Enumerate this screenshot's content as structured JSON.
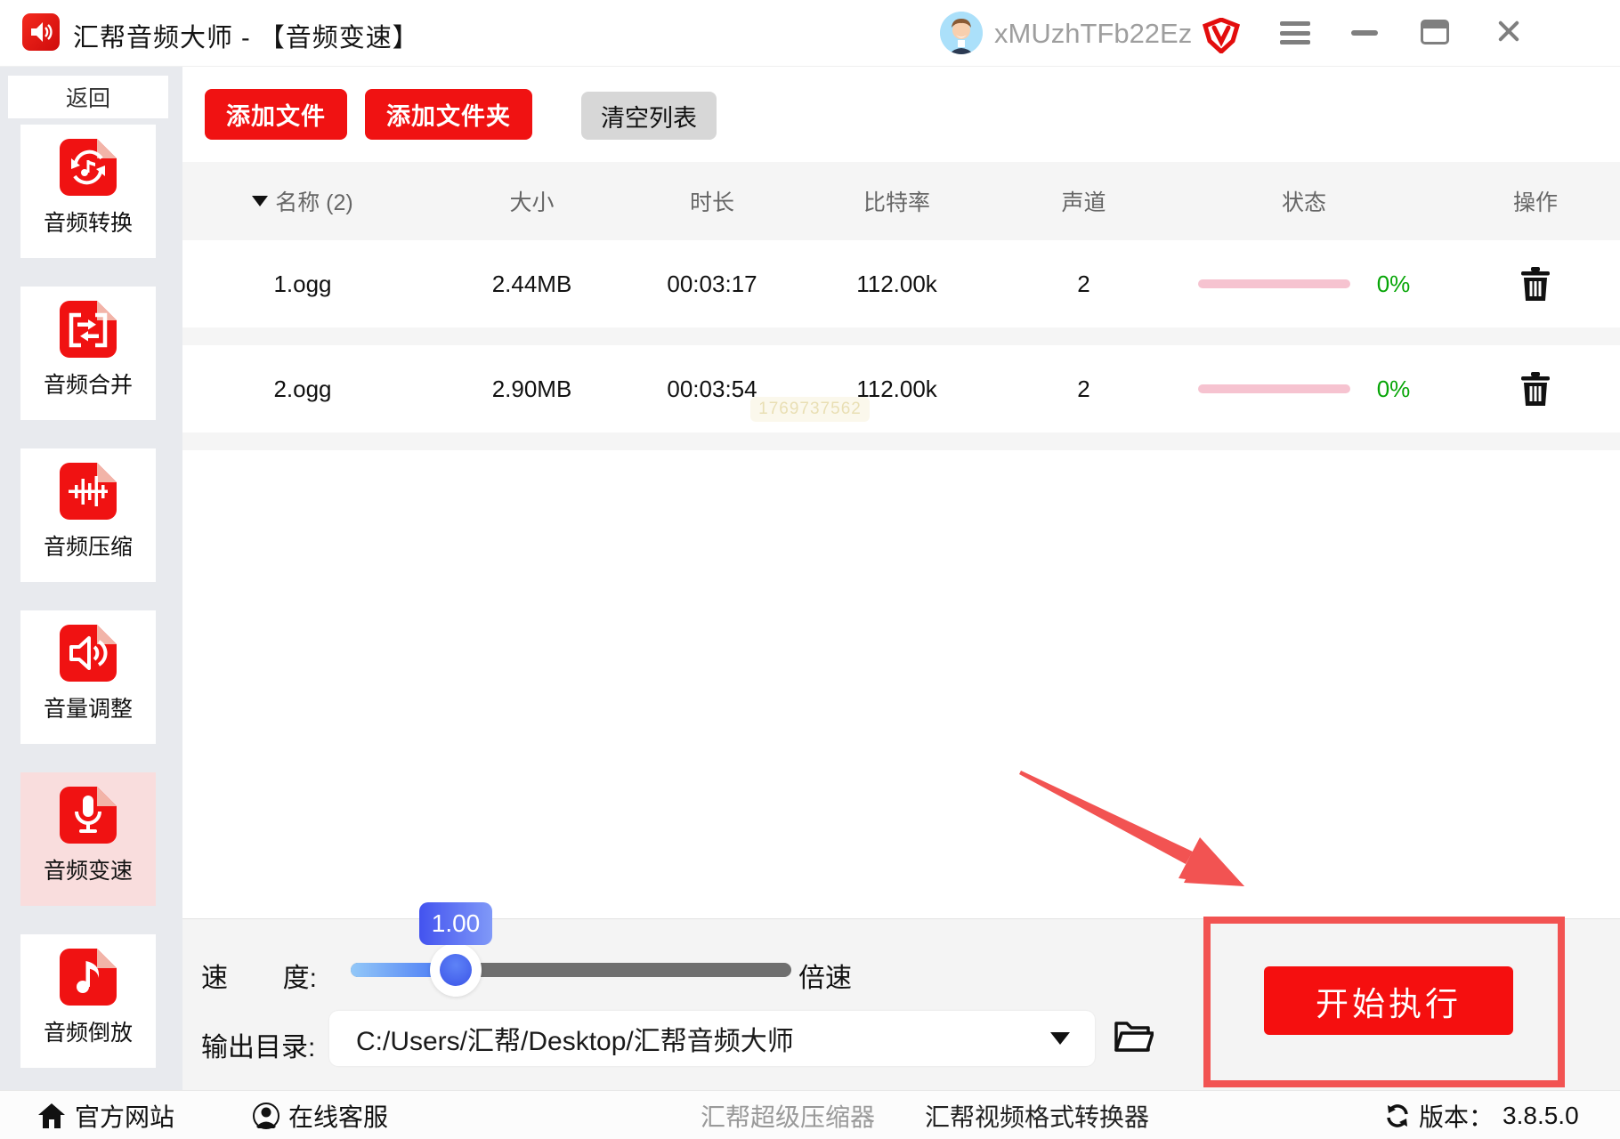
{
  "titlebar": {
    "app_title": "汇帮音频大师 - 【音频变速】",
    "username": "xMUzhTFb22Ez"
  },
  "sidebar": {
    "back_label": "返回",
    "items": [
      {
        "label": "音频转换",
        "selected": false
      },
      {
        "label": "音频合并",
        "selected": false
      },
      {
        "label": "音频压缩",
        "selected": false
      },
      {
        "label": "音量调整",
        "selected": false
      },
      {
        "label": "音频变速",
        "selected": true
      },
      {
        "label": "音频倒放",
        "selected": false
      }
    ]
  },
  "toolbar": {
    "add_file": "添加文件",
    "add_folder": "添加文件夹",
    "clear_list": "清空列表"
  },
  "table": {
    "headers": {
      "name": "名称 (2)",
      "size": "大小",
      "duration": "时长",
      "bitrate": "比特率",
      "channels": "声道",
      "status": "状态",
      "action": "操作"
    },
    "rows": [
      {
        "name": "1.ogg",
        "size": "2.44MB",
        "duration": "00:03:17",
        "bitrate": "112.00k",
        "channels": "2",
        "progress": "0%"
      },
      {
        "name": "2.ogg",
        "size": "2.90MB",
        "duration": "00:03:54",
        "bitrate": "112.00k",
        "channels": "2",
        "progress": "0%"
      }
    ]
  },
  "watermark": "1769737562",
  "speed": {
    "label_char1": "速",
    "label_char2": "度:",
    "value": "1.00",
    "unit": "倍速"
  },
  "output": {
    "label": "输出目录:",
    "path": "C:/Users/汇帮/Desktop/汇帮音频大师"
  },
  "action": {
    "start": "开始执行"
  },
  "footer": {
    "official_site": "官方网站",
    "online_support": "在线客服",
    "link_compressor": "汇帮超级压缩器",
    "link_video_converter": "汇帮视频格式转换器",
    "version_label": "版本：",
    "version_value": "3.8.5.0"
  },
  "colors": {
    "brand_red": "#f01212",
    "annotation_red": "#f25352",
    "selected_pink": "#f9dddd",
    "progress_pink": "#f6c3d0",
    "percent_green": "#06a506",
    "slider_blue": "#3f6ef4"
  }
}
